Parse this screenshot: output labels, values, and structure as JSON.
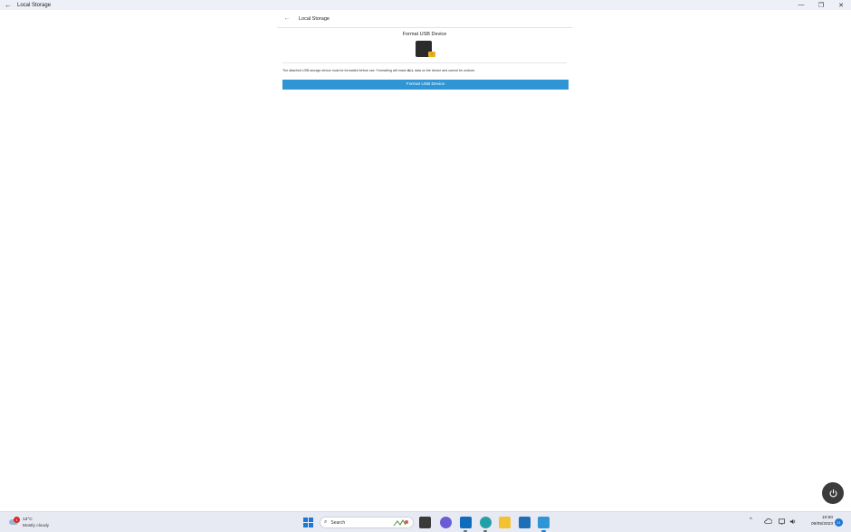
{
  "window": {
    "title": "Local Storage",
    "back_icon": "arrow-left-icon",
    "controls": [
      "minimize-icon",
      "restore-icon",
      "close-icon"
    ]
  },
  "panel": {
    "header_label": "Local Storage",
    "section_title": "Format USB Device",
    "usb_badge_text": "!",
    "message_before": "The attached USB storage device must be formatted before use. Formatting will erase ",
    "message_bold": "ALL",
    "message_after": " data on the device and cannot be undone.",
    "button_label": "Format USB Device",
    "accent_color": "#2f95d5"
  },
  "fab": {
    "icon": "power-icon"
  },
  "taskbar": {
    "weather": {
      "alert_count": "1",
      "temp": "13°C",
      "desc": "Mostly cloudy"
    },
    "search_placeholder": "Search",
    "apps": [
      "start-icon",
      "search-icon",
      "widgets-icon",
      "task-view-icon",
      "chat-icon",
      "outlook-icon",
      "edge-icon",
      "file-explorer-icon",
      "store-icon",
      "bing-icon"
    ],
    "tray": {
      "time": "10:50",
      "date": "09/05/2023",
      "notification_count": "21"
    }
  }
}
